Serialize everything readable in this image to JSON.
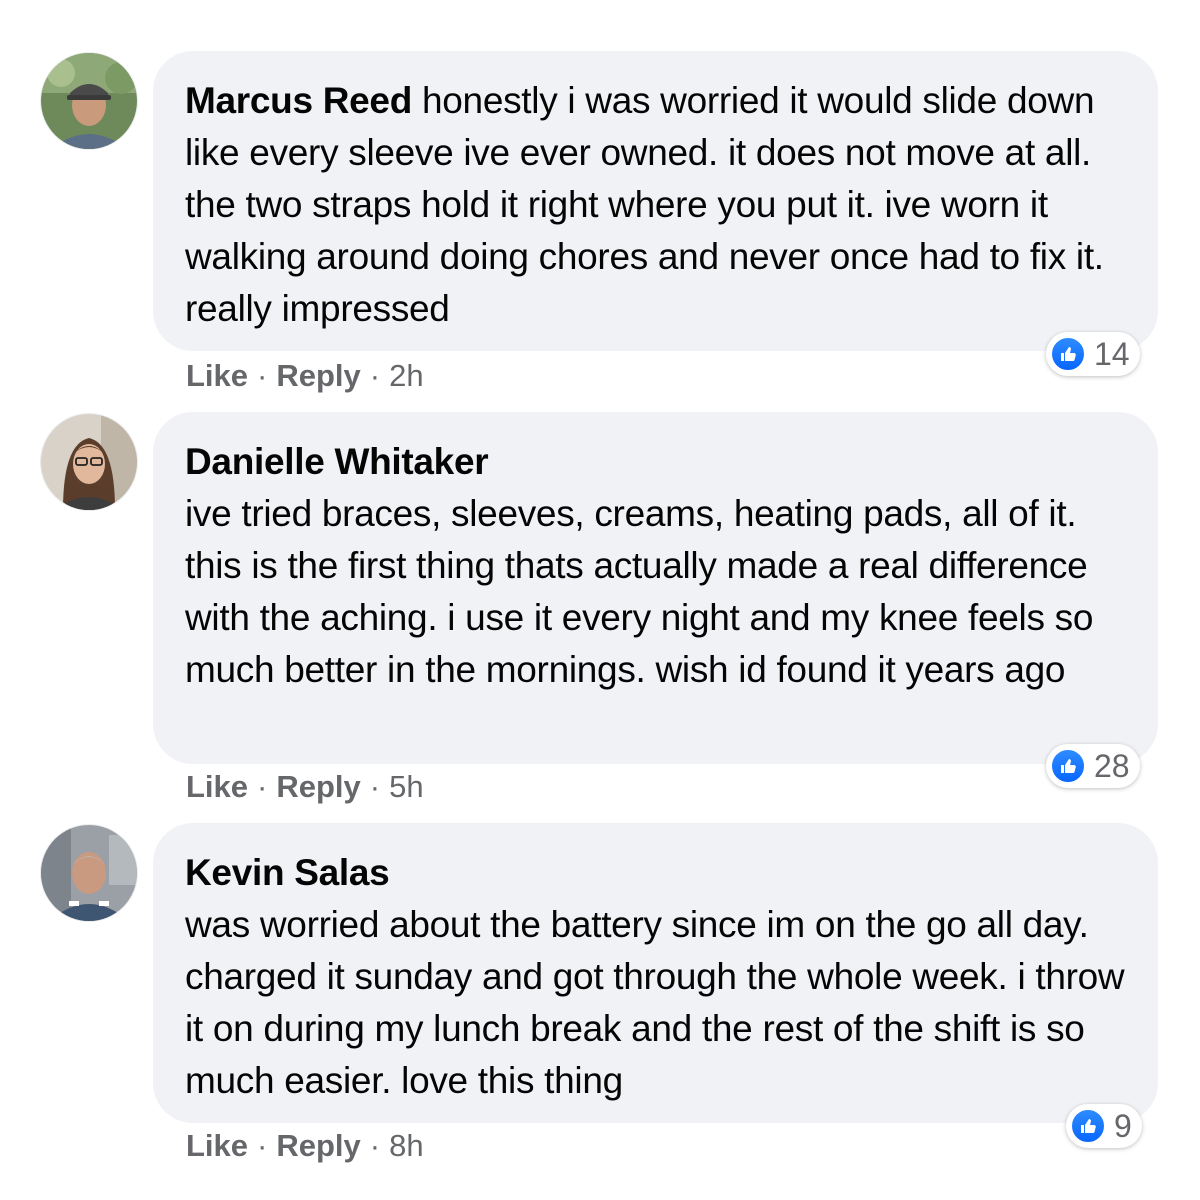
{
  "comments": [
    {
      "author": "Marcus Reed",
      "text": "honestly i was worried it would slide down like every sleeve ive ever owned. it does not move at all. the two straps hold it right where you put it. ive worn it walking around doing chores and never once had to fix it. really impressed",
      "reaction_count": "14",
      "like_label": "Like",
      "reply_label": "Reply",
      "time": "2h"
    },
    {
      "author": "Danielle Whitaker",
      "text": "ive tried braces, sleeves, creams, heating pads, all of it. this is the first thing thats actually made a real difference with the aching. i use it every night and my knee feels so much better in the mornings. wish id found it years ago",
      "reaction_count": "28",
      "like_label": "Like",
      "reply_label": "Reply",
      "time": "5h"
    },
    {
      "author": "Kevin Salas",
      "text": "was worried about the battery since im on the go all day. charged it sunday and got through the whole week. i throw it on during my lunch break and the rest of the shift is so much easier. love this thing",
      "reaction_count": "9",
      "like_label": "Like",
      "reply_label": "Reply",
      "time": "8h"
    }
  ],
  "separator": "·",
  "colors": {
    "bubble": "#f0f2f5",
    "meta_text": "#65676b",
    "like_blue": "#0866ff"
  },
  "icons": {
    "reaction": "thumbs-up-icon"
  }
}
